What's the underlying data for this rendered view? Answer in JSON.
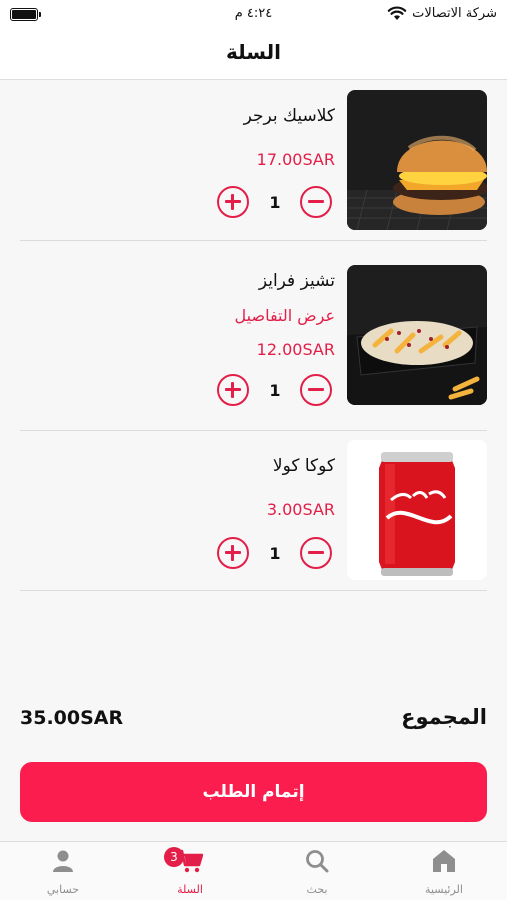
{
  "status_bar": {
    "carrier": "شركة الاتصالات",
    "time": "٤:٢٤ م"
  },
  "header": {
    "title": "السلة"
  },
  "cart": {
    "items": [
      {
        "name": "كلاسيك برجر",
        "details": "",
        "price": "17.00SAR",
        "quantity": "1"
      },
      {
        "name": "تشيز فرايز",
        "details": "عرض التفاصيل",
        "price": "12.00SAR",
        "quantity": "1"
      },
      {
        "name": "كوكا كولا",
        "details": "",
        "price": "3.00SAR",
        "quantity": "1"
      }
    ]
  },
  "summary": {
    "total_label": "المجموع",
    "total_value": "35.00SAR"
  },
  "checkout": {
    "label": "إتمام الطلب"
  },
  "tab_bar": {
    "tabs": [
      {
        "label": "حسابي",
        "icon": "user-icon"
      },
      {
        "label": "السلة",
        "icon": "cart-icon",
        "badge": "3"
      },
      {
        "label": "بحث",
        "icon": "search-icon"
      },
      {
        "label": "الرئيسية",
        "icon": "home-icon"
      }
    ]
  },
  "colors": {
    "accent": "#e31e48",
    "button": "#fb1d4e",
    "background": "#f7f7f7"
  }
}
